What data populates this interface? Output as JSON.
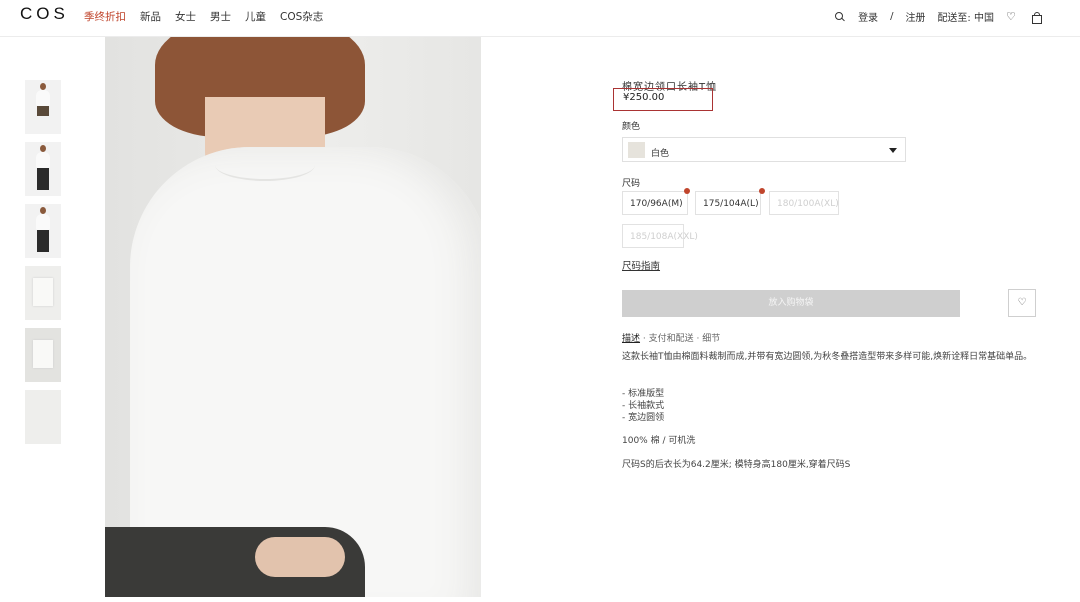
{
  "header": {
    "logo": "COS",
    "nav": [
      "季终折扣",
      "新品",
      "女士",
      "男士",
      "儿童",
      "COS杂志"
    ],
    "login": "登录",
    "separator": "/",
    "register": "注册",
    "ship_to": "配送至: 中国",
    "sale_color": "#c0452c"
  },
  "gallery": {
    "thumbnail_count": 6
  },
  "product": {
    "name": "棉宽边领口长袖T恤",
    "price": "¥250.00",
    "color_label": "颜色",
    "color_value": "白色",
    "size_label": "尺码",
    "sizes": [
      "170/96A(M)",
      "175/104A(L)",
      "180/100A(XL)",
      "185/108A(XXL)"
    ],
    "size_guide": "尺码指南",
    "add_to_bag": "放入购物袋",
    "tabs": [
      "描述",
      "支付和配送",
      "细节"
    ],
    "tab_sep": " · ",
    "description": "这款长袖T恤由棉面料裁制而成,并带有宽边圆领,为秋冬叠搭造型带来多样可能,焕新诠释日常基础单品。",
    "features": [
      "- 标准版型",
      "- 长袖款式",
      "- 宽边圆领"
    ],
    "material": "100% 棉 / 可机洗",
    "fit_note": "尺码S的后衣长为64.2厘米; 模特身高180厘米,穿着尺码S"
  }
}
